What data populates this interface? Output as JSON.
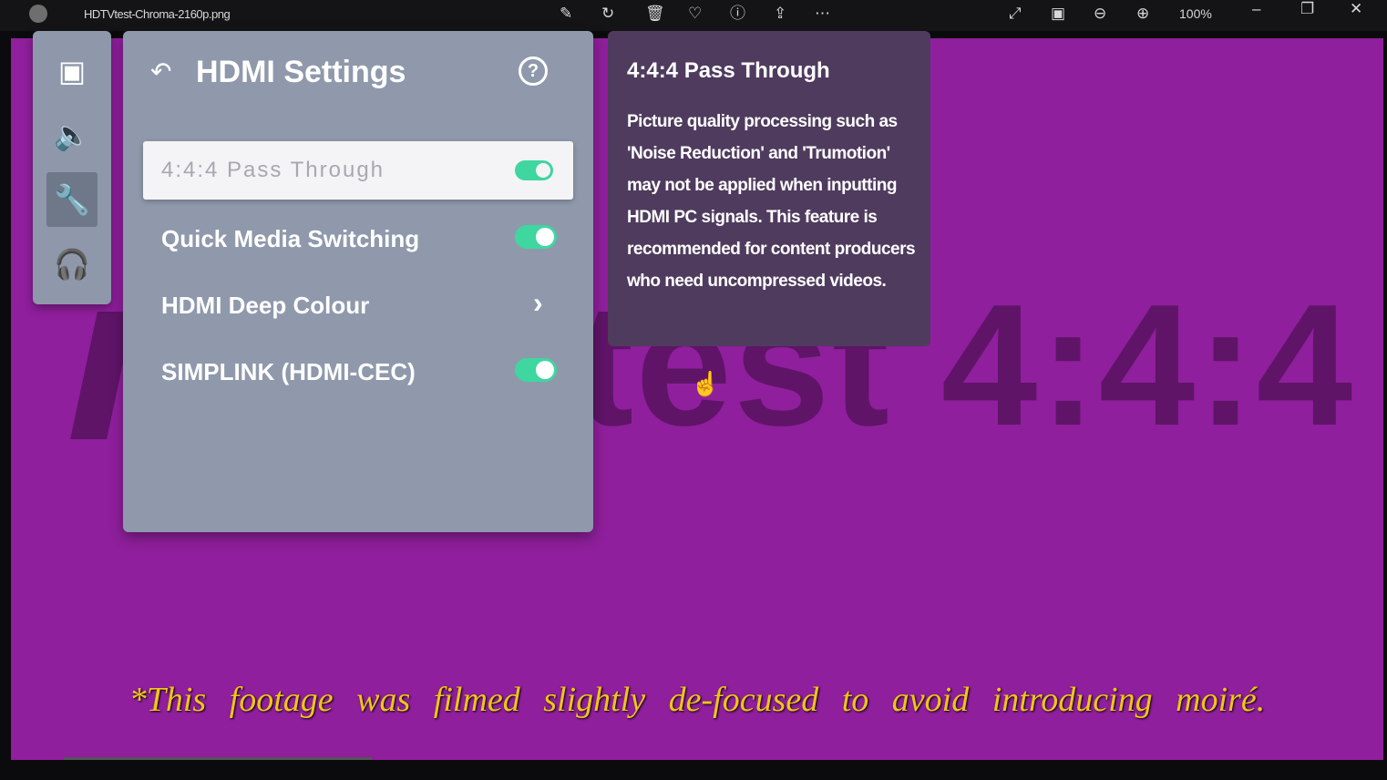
{
  "titlebar": {
    "filename": "HDTVtest-Chroma-2160p.png",
    "zoom": "100%",
    "icons": [
      "edit-icon",
      "rotate-icon",
      "delete-icon",
      "favorite-icon",
      "info-icon",
      "share-icon",
      "more-icon",
      "fullscreen-icon",
      "slideshow-icon",
      "zoom-out-icon",
      "zoom-in-icon",
      "minimize-icon",
      "restore-icon",
      "close-icon"
    ]
  },
  "background": {
    "text": "test 4:4:4",
    "color": "#8f1f9c"
  },
  "rail": {
    "items": [
      "picture",
      "sound",
      "general",
      "support"
    ],
    "active": "general"
  },
  "panel": {
    "title": "HDMI Settings",
    "rows": [
      {
        "label": "4:4:4 Pass Through",
        "toggle": true,
        "selected": true
      },
      {
        "label": "Quick Media Switching",
        "toggle": true
      },
      {
        "label": "HDMI Deep Colour",
        "chevron": true
      },
      {
        "label": "SIMPLINK (HDMI-CEC)",
        "toggle": true
      }
    ],
    "accent": "#3fd6a0"
  },
  "tooltip": {
    "title": "4:4:4 Pass Through",
    "body": "Picture quality processing such as 'Noise Reduction' and 'Trumotion' may not be applied when inputting HDMI PC signals. This feature is recommended for content producers who need uncompressed videos."
  },
  "caption": "*This footage was filmed slightly de-focused to avoid introducing moiré."
}
